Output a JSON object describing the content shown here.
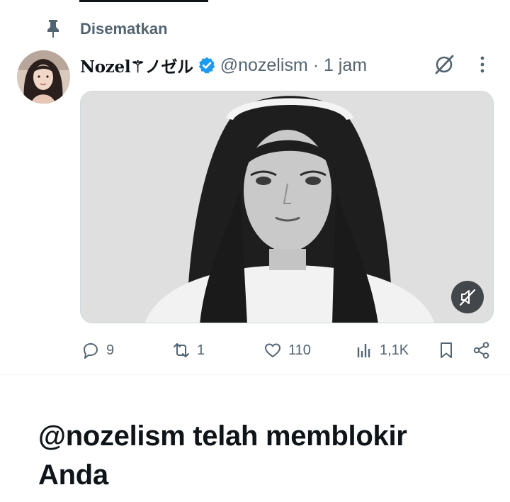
{
  "pinned": {
    "label": "Disematkan",
    "icon": "pin-icon"
  },
  "tweet": {
    "author": {
      "display_name": "Nozel⚚ノゼル",
      "handle_line": "@nozelism · 1 jam",
      "verified": true,
      "verified_color": "#1d9bf0"
    },
    "media": {
      "type": "video",
      "muted": true
    },
    "stats": {
      "replies": "9",
      "reposts": "1",
      "likes": "110",
      "views": "1,1K"
    }
  },
  "blocked_message": "@nozelism telah memblokir Anda",
  "colors": {
    "text": "#0f1419",
    "secondary": "#536471",
    "accent": "#1d9bf0",
    "border": "#cfd9de"
  }
}
